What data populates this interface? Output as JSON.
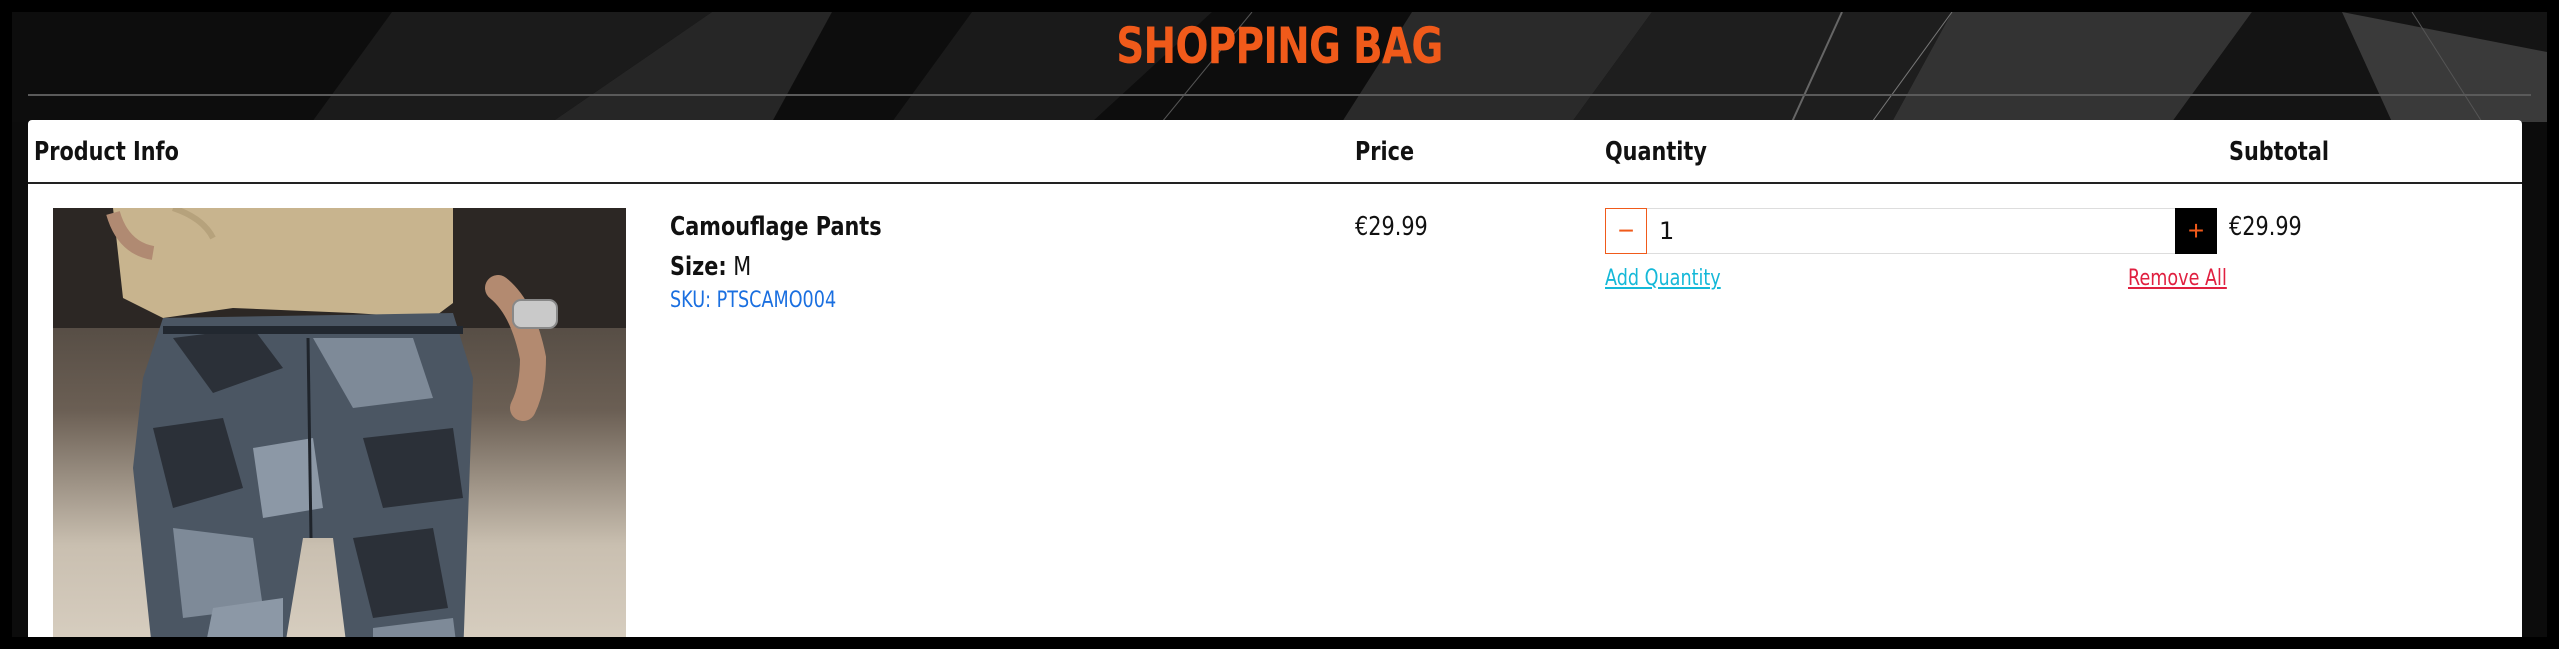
{
  "page": {
    "title": "SHOPPING BAG"
  },
  "cart": {
    "headers": {
      "product_info": "Product Info",
      "price": "Price",
      "quantity": "Quantity",
      "subtotal": "Subtotal"
    },
    "items": [
      {
        "name": "Camouflage Pants",
        "size_label": "Size:",
        "size_value": "M",
        "sku": "SKU: PTSCAMO004",
        "price": "€29.99",
        "quantity": "1",
        "subtotal": "€29.99",
        "image_icon": "product-photo-camouflage-pants"
      }
    ],
    "actions": {
      "minus_symbol": "−",
      "plus_symbol": "+",
      "add_quantity": "Add Quantity",
      "remove_all": "Remove All"
    }
  },
  "colors": {
    "accent_orange": "#f05a1a",
    "link_blue": "#1a6fe0",
    "add_cyan": "#14b8d8",
    "remove_red": "#e02040",
    "frame_bg": "#0c0c0c"
  }
}
